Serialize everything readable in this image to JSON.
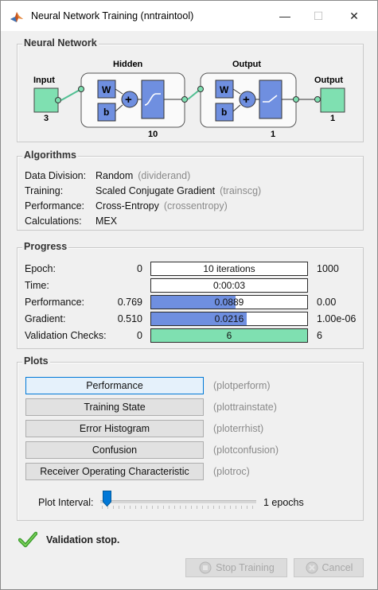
{
  "window": {
    "title": "Neural Network Training (nntraintool)"
  },
  "network": {
    "section_title": "Neural Network",
    "input_label": "Input",
    "input_size": "3",
    "hidden_label": "Hidden",
    "hidden_size": "10",
    "output_layer_label": "Output",
    "output_layer_size": "1",
    "output_label": "Output",
    "output_size": "1",
    "weight_symbol": "W",
    "bias_symbol": "b",
    "sum_symbol": "+"
  },
  "algorithms": {
    "section_title": "Algorithms",
    "rows": [
      {
        "label": "Data Division:",
        "value": "Random",
        "fn": "(dividerand)"
      },
      {
        "label": "Training:",
        "value": "Scaled Conjugate Gradient",
        "fn": "(trainscg)"
      },
      {
        "label": "Performance:",
        "value": "Cross-Entropy",
        "fn": "(crossentropy)"
      },
      {
        "label": "Calculations:",
        "value": "MEX",
        "fn": ""
      }
    ]
  },
  "progress": {
    "section_title": "Progress",
    "rows": [
      {
        "label": "Epoch:",
        "start": "0",
        "bar_text": "10 iterations",
        "end": "1000",
        "fill_fraction": 0.0,
        "fill_color": "#6f8fe0"
      },
      {
        "label": "Time:",
        "start": "",
        "bar_text": "0:00:03",
        "end": "",
        "fill_fraction": 0.0,
        "fill_color": "#6f8fe0"
      },
      {
        "label": "Performance:",
        "start": "0.769",
        "bar_text": "0.0889",
        "end": "0.00",
        "fill_fraction": 0.54,
        "fill_color": "#6f8fe0"
      },
      {
        "label": "Gradient:",
        "start": "0.510",
        "bar_text": "0.0216",
        "end": "1.00e-06",
        "fill_fraction": 0.61,
        "fill_color": "#6f8fe0"
      },
      {
        "label": "Validation Checks:",
        "start": "0",
        "bar_text": "6",
        "end": "6",
        "fill_fraction": 1.0,
        "fill_color": "#7fe0b1"
      }
    ]
  },
  "plots": {
    "section_title": "Plots",
    "buttons": [
      {
        "label": "Performance",
        "fn": "(plotperform)"
      },
      {
        "label": "Training State",
        "fn": "(plottrainstate)"
      },
      {
        "label": "Error Histogram",
        "fn": "(ploterrhist)"
      },
      {
        "label": "Confusion",
        "fn": "(plotconfusion)"
      },
      {
        "label": "Receiver Operating Characteristic",
        "fn": "(plotroc)"
      }
    ],
    "interval_label": "Plot Interval:",
    "interval_value": "1 epochs"
  },
  "status": {
    "text": "Validation stop.",
    "icon": "check-icon"
  },
  "footer": {
    "stop_label": "Stop Training",
    "cancel_label": "Cancel"
  },
  "colors": {
    "accent": "#0078d7",
    "node_green": "#7fe0b1",
    "layer_blue": "#6f8fe0",
    "progress_blue": "#6f8fe0"
  }
}
